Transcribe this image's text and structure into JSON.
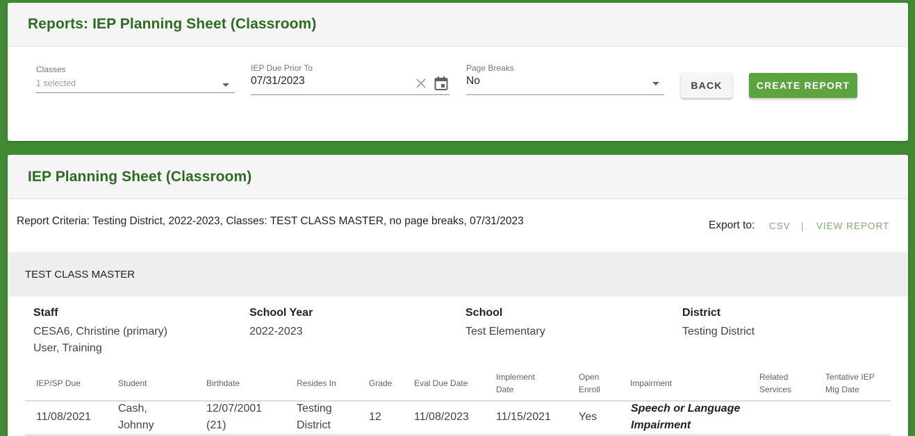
{
  "filter_card": {
    "title": "Reports: IEP Planning Sheet (Classroom)",
    "classes": {
      "label": "Classes",
      "placeholder": "1 selected"
    },
    "iep_due": {
      "label": "IEP Due Prior To",
      "value": "07/31/2023"
    },
    "page_breaks": {
      "label": "Page Breaks",
      "value": "No"
    },
    "back_label": "BACK",
    "create_label": "CREATE REPORT"
  },
  "report_card": {
    "title": "IEP Planning Sheet (Classroom)",
    "criteria": "Report Criteria: Testing District, 2022-2023, Classes: TEST CLASS MASTER, no page breaks, 07/31/2023",
    "export_label": "Export to:",
    "csv_label": "CSV",
    "separator": "|",
    "view_report_label": "VIEW REPORT",
    "class_name": "TEST CLASS MASTER",
    "info": {
      "staff_label": "Staff",
      "staff_values": [
        "CESA6, Christine (primary)",
        "User, Training"
      ],
      "school_year_label": "School Year",
      "school_year": "2022-2023",
      "school_label": "School",
      "school": "Test Elementary",
      "district_label": "District",
      "district": "Testing District"
    },
    "table": {
      "headers": {
        "iep_due": "IEP/SP Due",
        "student": "Student",
        "birthdate": "Birthdate",
        "resides_in": "Resides In",
        "grade": "Grade",
        "eval_due": "Eval Due Date",
        "implement_1": "Implement",
        "implement_2": "Date",
        "open_1": "Open",
        "open_2": "Enroll",
        "impairment": "Impairment",
        "related_1": "Related",
        "related_2": "Services",
        "tentative_1": "Tentative IEP",
        "tentative_2": "Mtg Date"
      },
      "rows": [
        {
          "iep_due": "11/08/2021",
          "student_1": "Cash,",
          "student_2": "Johnny",
          "birthdate_1": "12/07/2001",
          "birthdate_2": "(21)",
          "resides_1": "Testing",
          "resides_2": "District",
          "grade": "12",
          "eval_due": "11/08/2023",
          "implement": "11/15/2021",
          "open_enroll": "Yes",
          "impairment_1": "Speech or Language",
          "impairment_2": "Impairment"
        }
      ]
    }
  },
  "colors": {
    "background": "#3f8a33",
    "title": "#2e6b22",
    "primary_button": "#5da33f",
    "link": "#7fa875"
  },
  "icons": [
    "dropdown-caret-icon",
    "clear-icon",
    "calendar-icon"
  ]
}
